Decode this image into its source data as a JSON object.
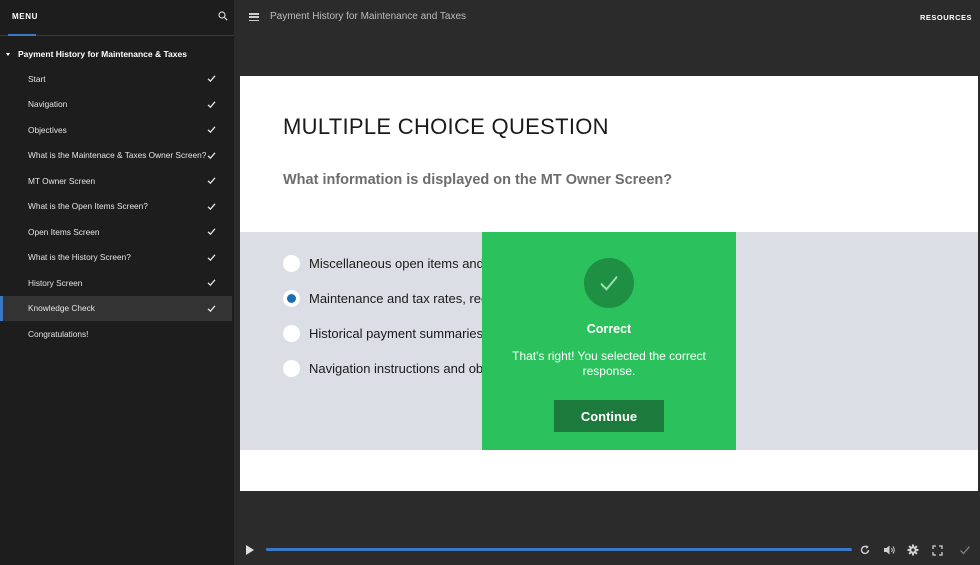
{
  "sidebar": {
    "menu_label": "MENU",
    "course_title": "Payment History for Maintenance & Taxes",
    "items": [
      {
        "label": "Start",
        "complete": true,
        "active": false
      },
      {
        "label": "Navigation",
        "complete": true,
        "active": false
      },
      {
        "label": "Objectives",
        "complete": true,
        "active": false
      },
      {
        "label": "What is the Maintenace & Taxes Owner Screen?",
        "complete": true,
        "active": false
      },
      {
        "label": "MT Owner Screen",
        "complete": true,
        "active": false
      },
      {
        "label": "What is the Open Items Screen?",
        "complete": true,
        "active": false
      },
      {
        "label": "Open Items Screen",
        "complete": true,
        "active": false
      },
      {
        "label": "What is the History Screen?",
        "complete": true,
        "active": false
      },
      {
        "label": "History Screen",
        "complete": true,
        "active": false
      },
      {
        "label": "Knowledge Check",
        "complete": true,
        "active": true
      },
      {
        "label": "Congratulations!",
        "complete": false,
        "active": false
      }
    ]
  },
  "header": {
    "title": "Payment History for Maintenance and Taxes",
    "resources_label": "RESOURCES"
  },
  "slide": {
    "heading": "MULTIPLE CHOICE QUESTION",
    "question": "What information is displayed on the MT Owner Screen?",
    "options": [
      {
        "label": "Miscellaneous open items and th",
        "selected": false
      },
      {
        "label": "Maintenance and tax rates, recur",
        "selected": true
      },
      {
        "label": "Historical payment summaries ar",
        "selected": false
      },
      {
        "label": "Navigation instructions and obje",
        "selected": false
      }
    ]
  },
  "feedback": {
    "title": "Correct",
    "message": "That's right!  You selected the correct response.",
    "button_label": "Continue"
  },
  "player": {
    "progress": 1.0
  },
  "colors": {
    "accent": "#3b78c3",
    "correct_green": "#2bc15c",
    "continue_button": "#1c7a3d"
  }
}
